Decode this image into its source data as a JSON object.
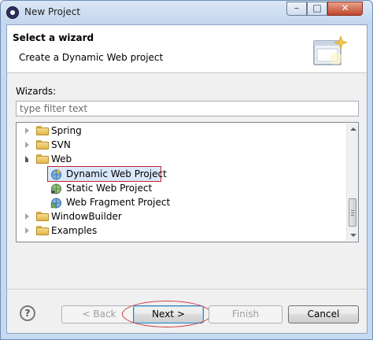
{
  "window": {
    "title": "New Project",
    "minimize_glyph": "–",
    "maximize_glyph": "□",
    "close_glyph": "✕"
  },
  "banner": {
    "title": "Select a wizard",
    "description": "Create a Dynamic Web project",
    "graphic_icon": "wizard-window-sparkle-icon"
  },
  "wizards": {
    "label": "Wizards:",
    "filter_placeholder": "type filter text",
    "filter_value": ""
  },
  "tree": {
    "items": [
      {
        "label": "Spring",
        "expanded": false,
        "icon": "folder-icon"
      },
      {
        "label": "SVN",
        "expanded": false,
        "icon": "folder-icon"
      },
      {
        "label": "Web",
        "expanded": true,
        "icon": "folder-icon",
        "children": [
          {
            "label": "Dynamic Web Project",
            "selected": true,
            "icon": "dynamic-web-project-icon"
          },
          {
            "label": "Static Web Project",
            "icon": "static-web-project-icon"
          },
          {
            "label": "Web Fragment Project",
            "icon": "web-fragment-project-icon"
          }
        ]
      },
      {
        "label": "WindowBuilder",
        "expanded": false,
        "icon": "folder-icon"
      },
      {
        "label": "Examples",
        "expanded": false,
        "icon": "folder-icon"
      }
    ]
  },
  "buttons": {
    "help": "?",
    "back": "< Back",
    "next": "Next >",
    "finish": "Finish",
    "cancel": "Cancel"
  },
  "colors": {
    "highlight_border": "#c9242a",
    "selection_bg": "#d9e8fb",
    "default_button_border": "#3c7fb1"
  }
}
